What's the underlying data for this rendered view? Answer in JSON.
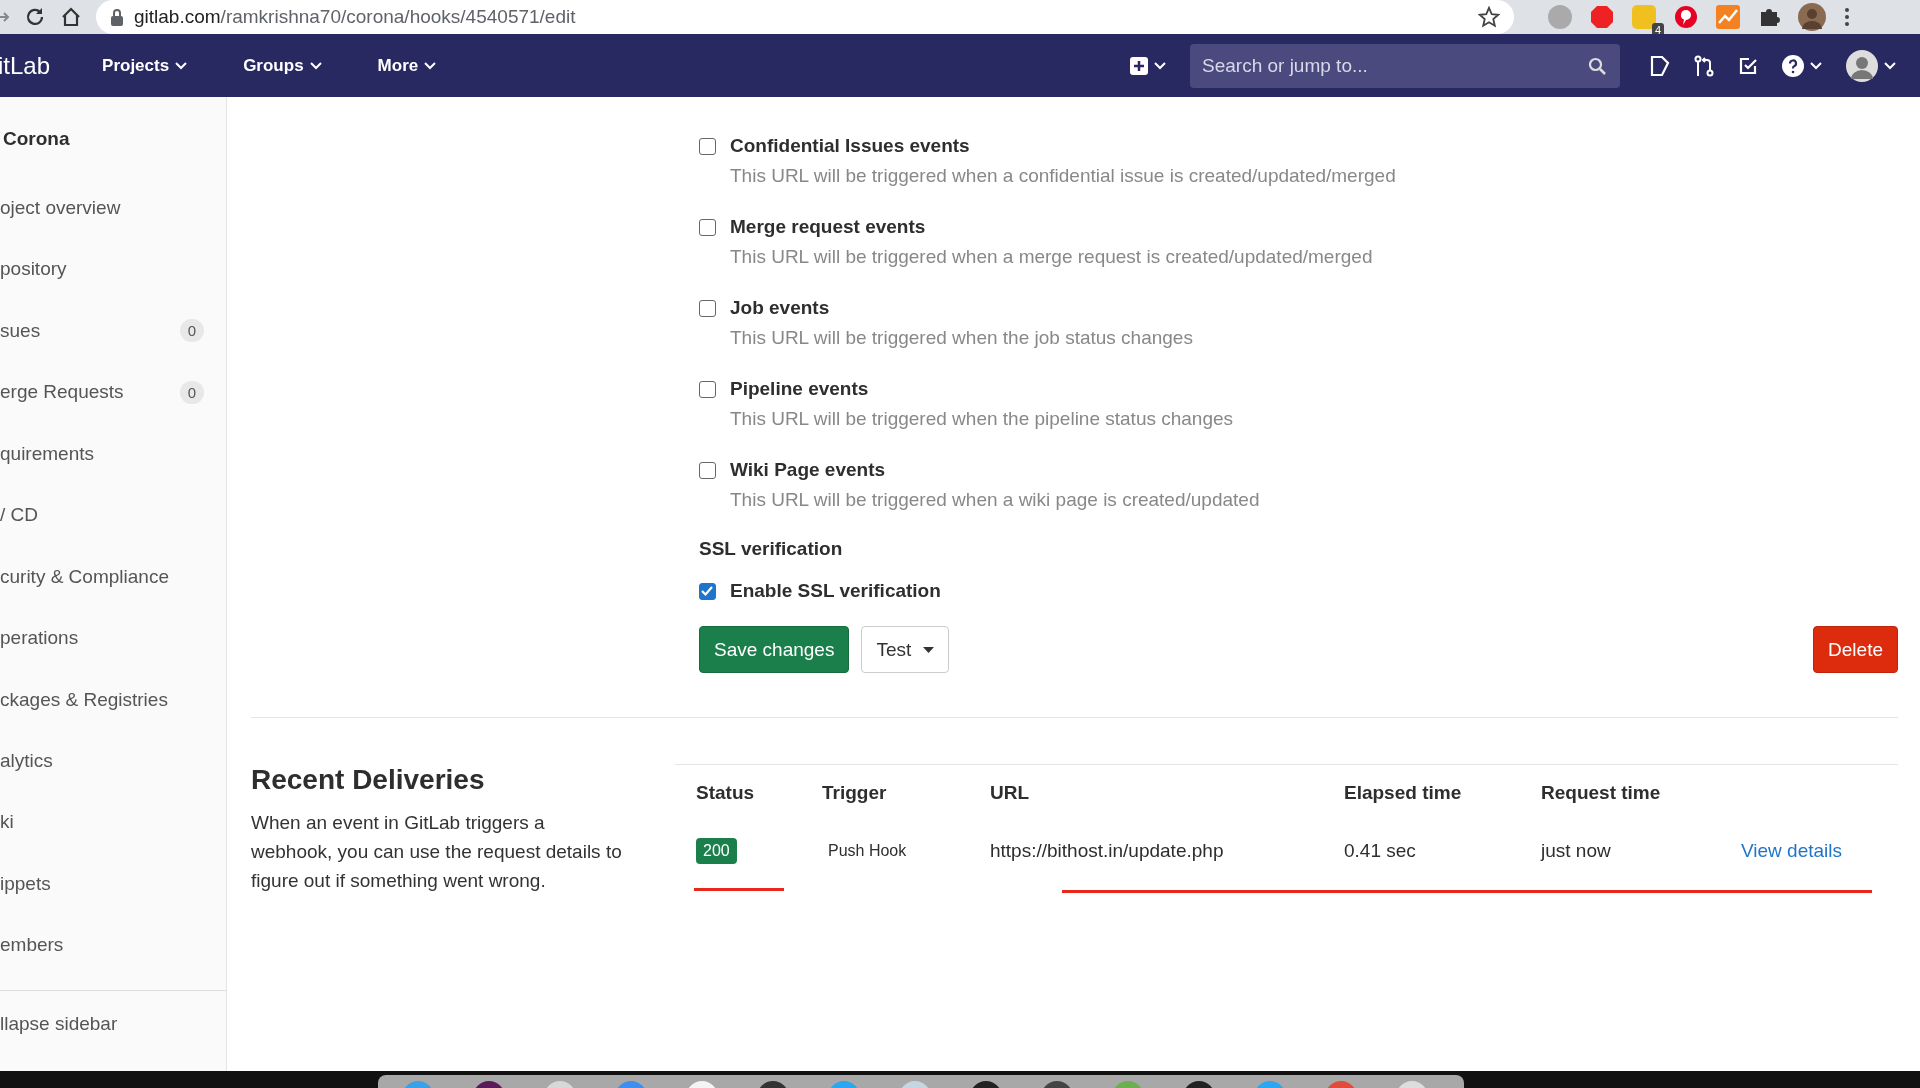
{
  "browser": {
    "url_host": "gitlab.com",
    "url_path": "/ramkrishna70/corona/hooks/4540571/edit",
    "extension_badge": "4"
  },
  "navbar": {
    "logo": "itLab",
    "menus": [
      "Projects",
      "Groups",
      "More"
    ],
    "search": {
      "placeholder": "Search or jump to..."
    }
  },
  "sidebar": {
    "project": "Corona",
    "items": [
      {
        "label": "oject overview"
      },
      {
        "label": "pository"
      },
      {
        "label": "sues",
        "count": "0"
      },
      {
        "label": "erge Requests",
        "count": "0"
      },
      {
        "label": "quirements"
      },
      {
        "label": "/ CD"
      },
      {
        "label": "curity & Compliance"
      },
      {
        "label": "perations"
      },
      {
        "label": "ckages & Registries"
      },
      {
        "label": "alytics"
      },
      {
        "label": "ki"
      },
      {
        "label": "ippets"
      },
      {
        "label": "embers"
      }
    ],
    "collapse": "llapse sidebar"
  },
  "triggers": [
    {
      "label": "Confidential Issues events",
      "description": "This URL will be triggered when a confidential issue is created/updated/merged",
      "checked": false
    },
    {
      "label": "Merge request events",
      "description": "This URL will be triggered when a merge request is created/updated/merged",
      "checked": false
    },
    {
      "label": "Job events",
      "description": "This URL will be triggered when the job status changes",
      "checked": false
    },
    {
      "label": "Pipeline events",
      "description": "This URL will be triggered when the pipeline status changes",
      "checked": false
    },
    {
      "label": "Wiki Page events",
      "description": "This URL will be triggered when a wiki page is created/updated",
      "checked": false
    }
  ],
  "ssl": {
    "heading": "SSL verification",
    "label": "Enable SSL verification",
    "checked": true
  },
  "buttons": {
    "save": "Save changes",
    "test": "Test",
    "delete": "Delete"
  },
  "deliveries": {
    "title": "Recent Deliveries",
    "description": "When an event in GitLab triggers a webhook, you can use the request details to figure out if something went wrong.",
    "columns": [
      "Status",
      "Trigger",
      "URL",
      "Elapsed time",
      "Request time"
    ],
    "rows": [
      {
        "status": "200",
        "trigger": "Push Hook",
        "url": "https://bithost.in/update.php",
        "elapsed": "0.41 sec",
        "request_time": "just now",
        "link": "View details"
      }
    ]
  }
}
